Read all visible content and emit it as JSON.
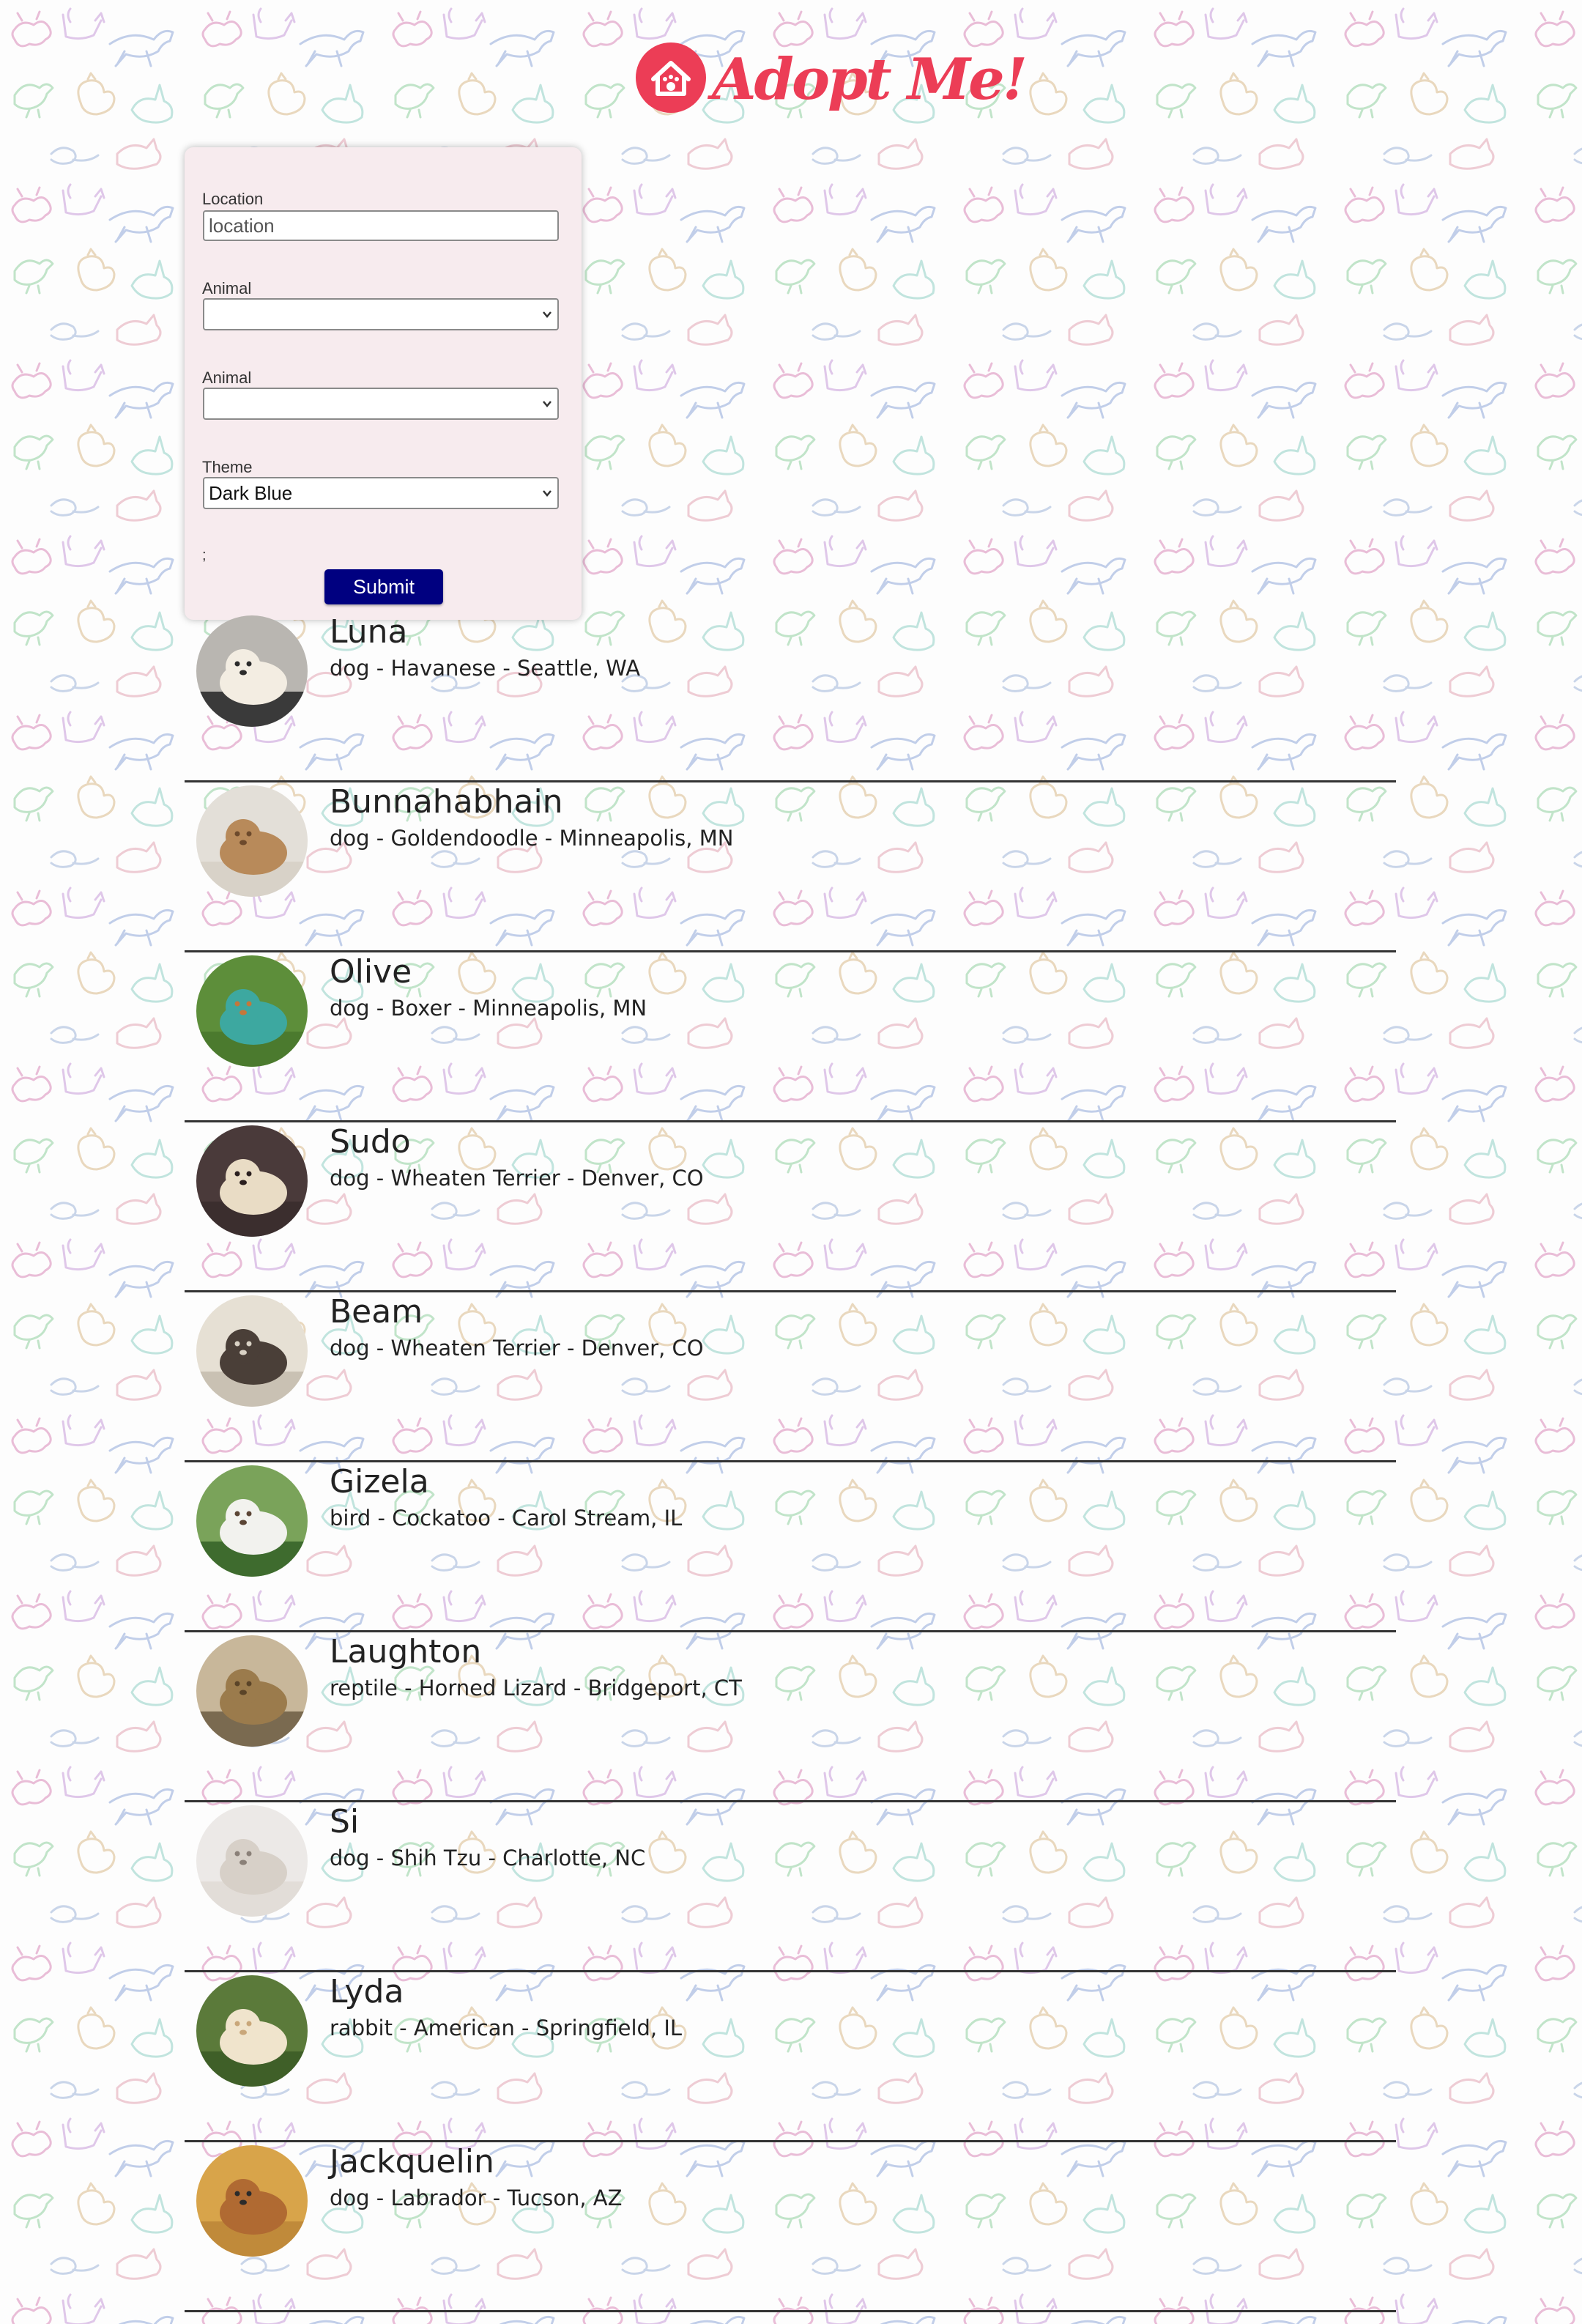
{
  "app": {
    "logo_text": "Adopt Me!",
    "brand_color": "#ec3d56",
    "logo_icon": "house-paw-icon"
  },
  "search": {
    "location_label": "Location",
    "location_placeholder": "location",
    "location_value": "",
    "animal_label": "Animal",
    "animal_value": "",
    "breed_label": "Animal",
    "breed_value": "",
    "theme_label": "Theme",
    "theme_value": "Dark Blue",
    "stray_text": ";",
    "submit_label": "Submit",
    "submit_color": "#000080"
  },
  "pets": [
    {
      "name": "Luna",
      "description": "dog - Havanese - Seattle, WA",
      "photo_icon": "havanese-photo"
    },
    {
      "name": "Bunnahabhain",
      "description": "dog - Goldendoodle - Minneapolis, MN",
      "photo_icon": "goldendoodle-photo"
    },
    {
      "name": "Olive",
      "description": "dog - Boxer - Minneapolis, MN",
      "photo_icon": "boxer-on-bench-photo"
    },
    {
      "name": "Sudo",
      "description": "dog - Wheaten Terrier - Denver, CO",
      "photo_icon": "wheaten-terrier-photo"
    },
    {
      "name": "Beam",
      "description": "dog - Wheaten Terrier - Denver, CO",
      "photo_icon": "curly-dog-photo"
    },
    {
      "name": "Gizela",
      "description": "bird - Cockatoo - Carol Stream, IL",
      "photo_icon": "cockatoo-photo"
    },
    {
      "name": "Laughton",
      "description": "reptile - Horned Lizard - Bridgeport, CT",
      "photo_icon": "lizard-photo"
    },
    {
      "name": "Si",
      "description": "dog - Shih Tzu - Charlotte, NC",
      "photo_icon": "shih-tzu-photo"
    },
    {
      "name": "Lyda",
      "description": "rabbit - American - Springfield, IL",
      "photo_icon": "rabbit-photo"
    },
    {
      "name": "Jackquelin",
      "description": "dog - Labrador - Tucson, AZ",
      "photo_icon": "labrador-photo"
    }
  ]
}
